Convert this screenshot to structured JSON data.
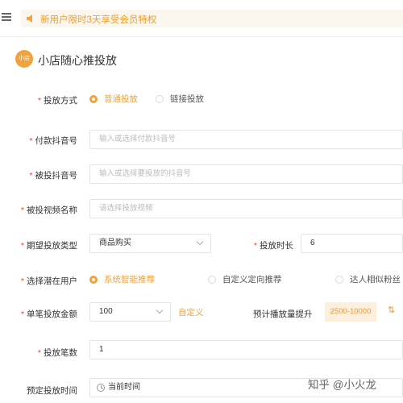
{
  "notice": {
    "text": "新用户限时3天享受会员特权"
  },
  "header": {
    "logo_text": "小店",
    "title": "小店随心推投放"
  },
  "form": {
    "delivery_mode": {
      "label": "投放方式",
      "options": [
        "普通投放",
        "链接投放"
      ],
      "selected": "普通投放"
    },
    "payer_account": {
      "label": "付款抖音号",
      "placeholder": "输入或选择付款抖音号"
    },
    "target_account": {
      "label": "被投抖音号",
      "placeholder": "输入或选择要投放的抖音号"
    },
    "video_name": {
      "label": "被投视频名称",
      "placeholder": "请选择投放视频"
    },
    "goal_type": {
      "label": "期望投放类型",
      "value": "商品购买"
    },
    "duration": {
      "label": "投放时长",
      "value": "6"
    },
    "audience": {
      "label": "选择潜在用户",
      "options": [
        "系统智能推荐",
        "自定义定向推荐",
        "达人相似粉丝"
      ],
      "selected": "系统智能推荐"
    },
    "budget": {
      "label": "单笔投放金额",
      "value": "100",
      "custom_link": "自定义",
      "forecast_label": "预计播放量提升",
      "forecast_value": "2500-10000"
    },
    "count": {
      "label": "投放笔数",
      "value": "1"
    },
    "schedule": {
      "label": "预定投放时间",
      "value": "当前时间"
    }
  },
  "watermark": {
    "text": "知乎 @小火龙"
  },
  "colors": {
    "accent": "#f0a33d",
    "required": "#e5452f",
    "notice_bg": "#fbf7ee"
  }
}
